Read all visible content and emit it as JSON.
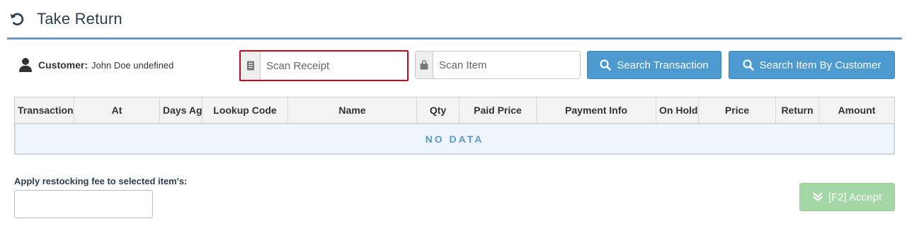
{
  "header": {
    "title": "Take Return",
    "icon": "undo-icon"
  },
  "customer": {
    "label": "Customer:",
    "value": "John Doe undefined",
    "icon": "user-icon"
  },
  "scan_receipt": {
    "placeholder": "Scan Receipt",
    "value": "",
    "icon": "receipt-icon"
  },
  "scan_item": {
    "placeholder": "Scan Item",
    "value": "",
    "icon": "bag-icon"
  },
  "buttons": {
    "search_transaction": "Search Transaction",
    "search_item_by_customer": "Search Item By Customer",
    "accept": "[F2] Accept"
  },
  "table": {
    "columns": [
      "Transaction",
      "At",
      "Days Ago",
      "Lookup Code",
      "Name",
      "Qty",
      "Paid Price",
      "Payment Info",
      "On Hold",
      "Price",
      "Return",
      "Amount"
    ],
    "empty_text": "NO DATA"
  },
  "restocking": {
    "label": "Apply restocking fee to selected item's:",
    "value": ""
  },
  "colors": {
    "primary": "#4c9ad0",
    "accent_disabled": "#a3d8a6",
    "highlight_border": "#d0021b",
    "header_rule": "#6b9ac4"
  }
}
